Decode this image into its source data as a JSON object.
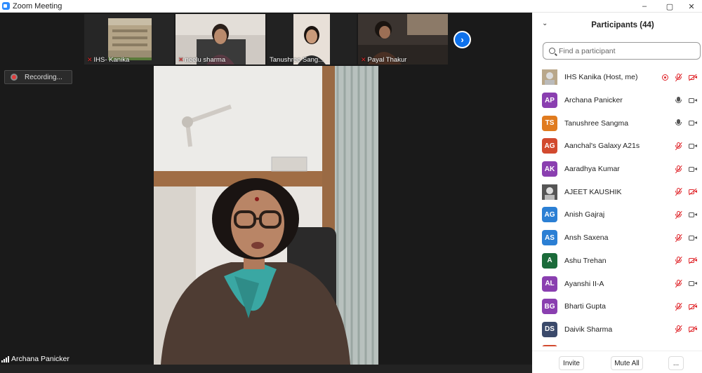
{
  "window": {
    "title": "Zoom Meeting",
    "controls": [
      "–",
      "▢",
      "✕"
    ]
  },
  "thumbnails": [
    {
      "name": "IHS- Kanika",
      "muted": true
    },
    {
      "name": "neelu sharma",
      "muted": true
    },
    {
      "name": "Tanushree Sang...",
      "muted": false
    },
    {
      "name": "Payal Thakur",
      "muted": true
    }
  ],
  "next_button": "›",
  "recording": {
    "label": "Recording..."
  },
  "active_speaker": {
    "name": "Archana Panicker"
  },
  "panel": {
    "title": "Participants (44)",
    "collapse_glyph": "⌄",
    "search_placeholder": "Find a participant",
    "participants": [
      {
        "initials": "",
        "name": "IHS  Kanika (Host, me)",
        "color": "#b9a78a",
        "photo": true,
        "mic": "off",
        "cam": "off",
        "target": true
      },
      {
        "initials": "AP",
        "name": "Archana Panicker",
        "color": "#8a3fb0",
        "mic": "on",
        "cam": "on"
      },
      {
        "initials": "TS",
        "name": "Tanushree Sangma",
        "color": "#e07b1f",
        "mic": "on",
        "cam": "on"
      },
      {
        "initials": "AG",
        "name": "Aanchal's Galaxy A21s",
        "color": "#d24a2f",
        "mic": "off",
        "cam": "on"
      },
      {
        "initials": "AK",
        "name": "Aaradhya Kumar",
        "color": "#8a3fb0",
        "mic": "off",
        "cam": "on"
      },
      {
        "initials": "",
        "name": "AJEET KAUSHIK",
        "color": "#555555",
        "photo": true,
        "mic": "off",
        "cam": "off"
      },
      {
        "initials": "AG",
        "name": "Anish Gajraj",
        "color": "#2b7fd4",
        "mic": "off",
        "cam": "on"
      },
      {
        "initials": "AS",
        "name": "Ansh Saxena",
        "color": "#2b7fd4",
        "mic": "off",
        "cam": "on"
      },
      {
        "initials": "A",
        "name": "Ashu Trehan",
        "color": "#1b6b3a",
        "mic": "off",
        "cam": "off"
      },
      {
        "initials": "AL",
        "name": "Ayanshi II-A",
        "color": "#8a3fb0",
        "mic": "off",
        "cam": "on"
      },
      {
        "initials": "BG",
        "name": "Bharti Gupta",
        "color": "#8a3fb0",
        "mic": "off",
        "cam": "off"
      },
      {
        "initials": "DS",
        "name": "Daivik Sharma",
        "color": "#3b4a6b",
        "mic": "off",
        "cam": "off"
      },
      {
        "initials": "D",
        "name": "D...",
        "color": "#d24a2f",
        "mic": "off",
        "cam": "off"
      }
    ],
    "footer": {
      "invite": "Invite",
      "mute_all": "Mute All",
      "more": "..."
    }
  }
}
